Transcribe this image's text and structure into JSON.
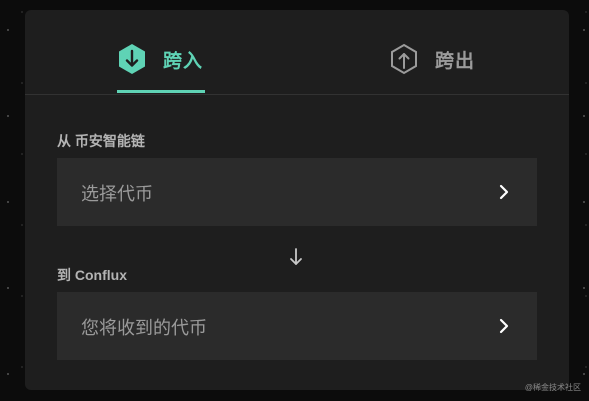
{
  "colors": {
    "accent": "#5fd3b5",
    "card": "#1e1e1e",
    "field": "#2b2b2b",
    "muted": "#9b9b9b"
  },
  "tabs": [
    {
      "label": "跨入",
      "icon": "shield-down-arrow-icon",
      "active": true
    },
    {
      "label": "跨出",
      "icon": "shield-up-arrow-icon",
      "active": false
    }
  ],
  "from": {
    "label": "从 币安智能链",
    "placeholder": "选择代币",
    "icon": "chevron-right-icon"
  },
  "direction_icon": "arrow-down-icon",
  "to": {
    "label": "到 Conflux",
    "placeholder": "您将收到的代币",
    "icon": "chevron-right-icon"
  },
  "watermark": "@稀金技术社区"
}
